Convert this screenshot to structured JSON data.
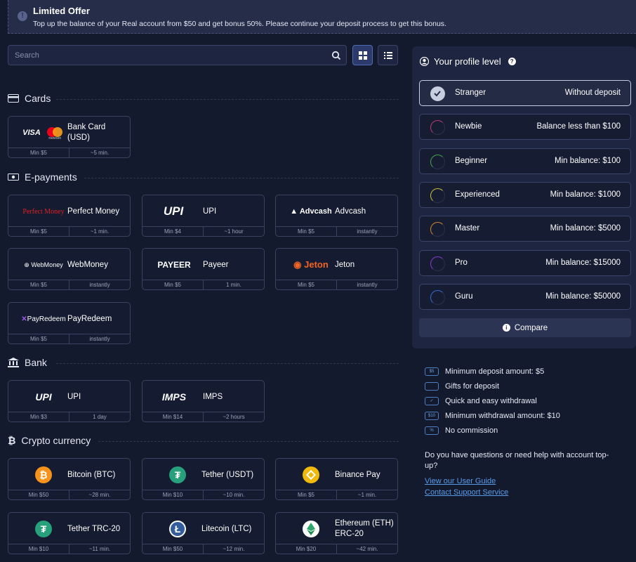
{
  "banner": {
    "title": "Limited Offer",
    "text": "Top up the balance of your Real account from $50 and get bonus 50%. Please continue your deposit process to get this bonus."
  },
  "search": {
    "placeholder": "Search"
  },
  "sections": {
    "cards": "Cards",
    "epayments": "E-payments",
    "bank": "Bank",
    "crypto": "Crypto currency"
  },
  "methods": {
    "bank_card": {
      "name": "Bank Card (USD)",
      "min": "Min $5",
      "time": "~5 min."
    },
    "perfect_money": {
      "name": "Perfect Money",
      "min": "Min $5",
      "time": "~1 min."
    },
    "upi": {
      "name": "UPI",
      "min": "Min $4",
      "time": "~1 hour"
    },
    "advcash": {
      "name": "Advcash",
      "min": "Min $5",
      "time": "instantly"
    },
    "webmoney": {
      "name": "WebMoney",
      "min": "Min $5",
      "time": "instantly"
    },
    "payeer": {
      "name": "Payeer",
      "min": "Min $5",
      "time": "1 min."
    },
    "jeton": {
      "name": "Jeton",
      "min": "Min $5",
      "time": "instantly"
    },
    "payredeem": {
      "name": "PayRedeem",
      "min": "Min $5",
      "time": "instantly"
    },
    "bank_upi": {
      "name": "UPI",
      "min": "Min $3",
      "time": "1 day"
    },
    "imps": {
      "name": "IMPS",
      "min": "Min $14",
      "time": "~2 hours"
    },
    "btc": {
      "name": "Bitcoin (BTC)",
      "min": "Min $50",
      "time": "~28 min."
    },
    "usdt": {
      "name": "Tether (USDT)",
      "min": "Min $10",
      "time": "~10 min."
    },
    "binance": {
      "name": "Binance Pay",
      "min": "Min $5",
      "time": "~1 min."
    },
    "trc20": {
      "name": "Tether TRC-20",
      "min": "Min $10",
      "time": "~11 min."
    },
    "ltc": {
      "name": "Litecoin (LTC)",
      "min": "Min $50",
      "time": "~12 min."
    },
    "eth": {
      "name": "Ethereum (ETH) ERC-20",
      "min": "Min $20",
      "time": "~42 min."
    }
  },
  "logos": {
    "visa": "VISA",
    "mastercard": "mastercard",
    "perfect_money": "Perfect Money",
    "upi": "UPI",
    "advcash": "Advcash",
    "webmoney": "WebMoney",
    "payeer": "PAYEER",
    "jeton": "Jeton",
    "payredeem": "PayRedeem",
    "imps": "IMPS"
  },
  "profile": {
    "title": "Your profile level",
    "levels": [
      {
        "name": "Stranger",
        "req": "Without deposit",
        "color": "#c9cde0"
      },
      {
        "name": "Newbie",
        "req": "Balance less than $100",
        "color": "#c23a7a"
      },
      {
        "name": "Beginner",
        "req": "Min balance: $100",
        "color": "#4aa84a"
      },
      {
        "name": "Experienced",
        "req": "Min balance: $1000",
        "color": "#d6c23a"
      },
      {
        "name": "Master",
        "req": "Min balance: $5000",
        "color": "#d68a2a"
      },
      {
        "name": "Pro",
        "req": "Min balance: $15000",
        "color": "#8a3ad6"
      },
      {
        "name": "Guru",
        "req": "Min balance: $50000",
        "color": "#3a6ad6"
      }
    ],
    "compare": "Compare"
  },
  "features": [
    {
      "icon": "$5",
      "text": "Minimum deposit amount: $5"
    },
    {
      "icon": "",
      "text": "Gifts for deposit"
    },
    {
      "icon": "✓",
      "text": "Quick and easy withdrawal"
    },
    {
      "icon": "$10",
      "text": "Minimum withdrawal amount: $10"
    },
    {
      "icon": "%",
      "text": "No commission"
    }
  ],
  "help": {
    "question": "Do you have questions or need help with account top-up?",
    "guide": "View our User Guide",
    "support": "Contact Support Service"
  }
}
